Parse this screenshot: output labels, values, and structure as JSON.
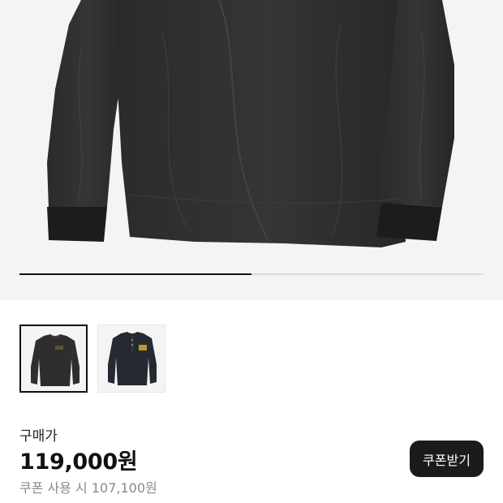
{
  "gallery": {
    "image_count": 2,
    "progress_fraction": 0.5,
    "thumbnails": [
      {
        "alt": "검정 워싱 헨리넥 긴팔 티셔츠 정면",
        "selected": true
      },
      {
        "alt": "검정 헨리넥 긴팔 티셔츠 그래픽",
        "selected": false
      }
    ]
  },
  "pricing": {
    "label": "구매가",
    "price": "119,000원",
    "coupon_price": "쿠폰 사용 시 107,100원",
    "coupon_button_label": "쿠폰받기"
  },
  "colors": {
    "background": "#ffffff",
    "image_background": "#f4f4f4",
    "shirt": "#2a2a2a",
    "button": "#1b1b1b",
    "muted_text": "#8a8a8a"
  }
}
